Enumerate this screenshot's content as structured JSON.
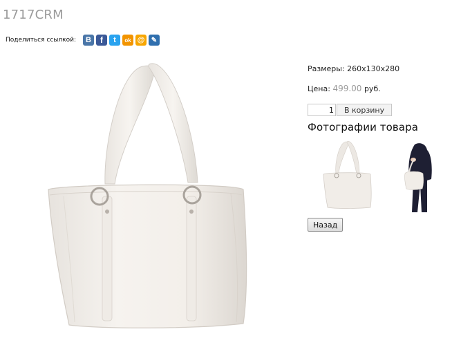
{
  "product": {
    "title": "1717CRM",
    "dimensions_text": "Размеры: 260x130x280",
    "price_label": "Цена:",
    "price_value": "499.00",
    "price_currency": "руб.",
    "quantity": "1",
    "add_to_cart_label": "В корзину"
  },
  "share": {
    "label": "Поделиться ссылкой:",
    "icons": [
      {
        "name": "vkontakte-icon",
        "glyph": "B",
        "color": "#4a76a8"
      },
      {
        "name": "facebook-icon",
        "glyph": "f",
        "color": "#3b5998"
      },
      {
        "name": "twitter-icon",
        "glyph": "t",
        "color": "#2aa3ef"
      },
      {
        "name": "odnoklassniki-icon",
        "glyph": "ok",
        "color": "#f29400"
      },
      {
        "name": "mailru-icon",
        "glyph": "@",
        "color": "#f7a600"
      },
      {
        "name": "livejournal-icon",
        "glyph": "✎",
        "color": "#2f6fae"
      }
    ]
  },
  "gallery": {
    "heading": "Фотографии товара"
  },
  "navigation": {
    "back_label": "Назад"
  }
}
